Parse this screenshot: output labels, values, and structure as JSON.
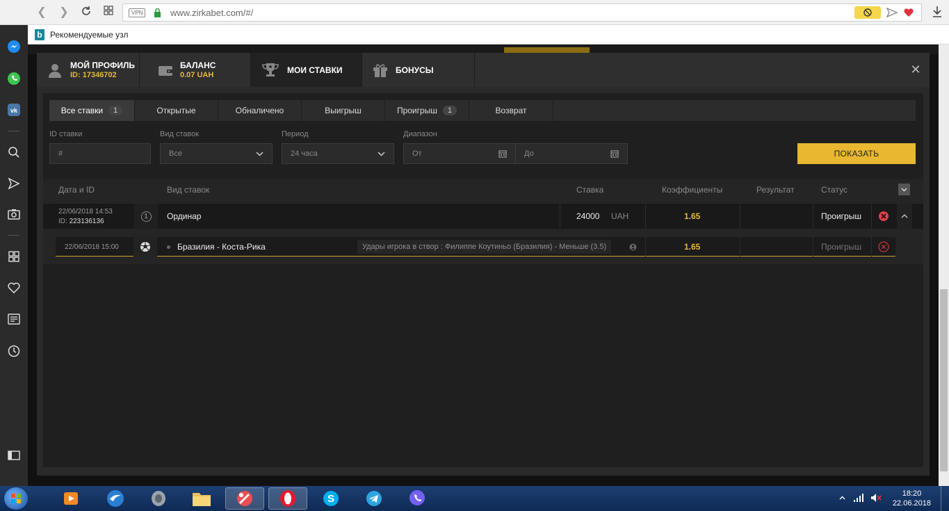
{
  "browser": {
    "vpn_label": "VPN",
    "url": "www.zirkabet.com/#/",
    "bookmark_label": "Рекомендуемые узл"
  },
  "modal": {
    "tabs": [
      {
        "title": "МОЙ ПРОФИЛЬ",
        "sub": "ID: 17346702",
        "icon": "user-icon"
      },
      {
        "title": "БАЛАНС",
        "sub": "0.07 UAH",
        "icon": "wallet-icon"
      },
      {
        "title": "МОИ СТАВКИ",
        "sub": "",
        "icon": "trophy-icon"
      },
      {
        "title": "БОНУСЫ",
        "sub": "",
        "icon": "gift-icon"
      }
    ],
    "close": "✕"
  },
  "filter_tabs": [
    {
      "label": "Все ставки",
      "count": "1"
    },
    {
      "label": "Открытые",
      "count": ""
    },
    {
      "label": "Обналичено",
      "count": ""
    },
    {
      "label": "Выигрыш",
      "count": ""
    },
    {
      "label": "Проигрыш",
      "count": "1"
    },
    {
      "label": "Возврат",
      "count": ""
    }
  ],
  "filters": {
    "bet_id_label": "ID ставки",
    "bet_id_placeholder": "#",
    "bet_type_label": "Вид ставок",
    "bet_type_value": "Все",
    "period_label": "Период",
    "period_value": "24 часа",
    "range_label": "Диапазон",
    "from_placeholder": "От",
    "to_placeholder": "До",
    "show_button": "ПОКАЗАТЬ"
  },
  "table": {
    "headers": {
      "date_id": "Дата и ID",
      "bet_type": "Вид ставок",
      "stake": "Ставка",
      "coef": "Коэффициенты",
      "result": "Результат",
      "status": "Статус"
    },
    "bet": {
      "date": "22/06/2018 14:53",
      "id_prefix": "ID:",
      "id": "223136136",
      "count": "1",
      "type": "Ординар",
      "stake": "24000",
      "currency": "UAH",
      "coef": "1.65",
      "status": "Проигрыш"
    },
    "event": {
      "date": "22/06/2018 15:00",
      "match": "Бразилия - Коста-Рика",
      "market": "Удары игрока в створ : Филиппе Коутиньо (Бразилия) - Меньше (3.5)",
      "coef": "1.65",
      "status": "Проигрыш"
    }
  },
  "taskbar": {
    "time": "18:20",
    "date": "22.06.2018"
  }
}
